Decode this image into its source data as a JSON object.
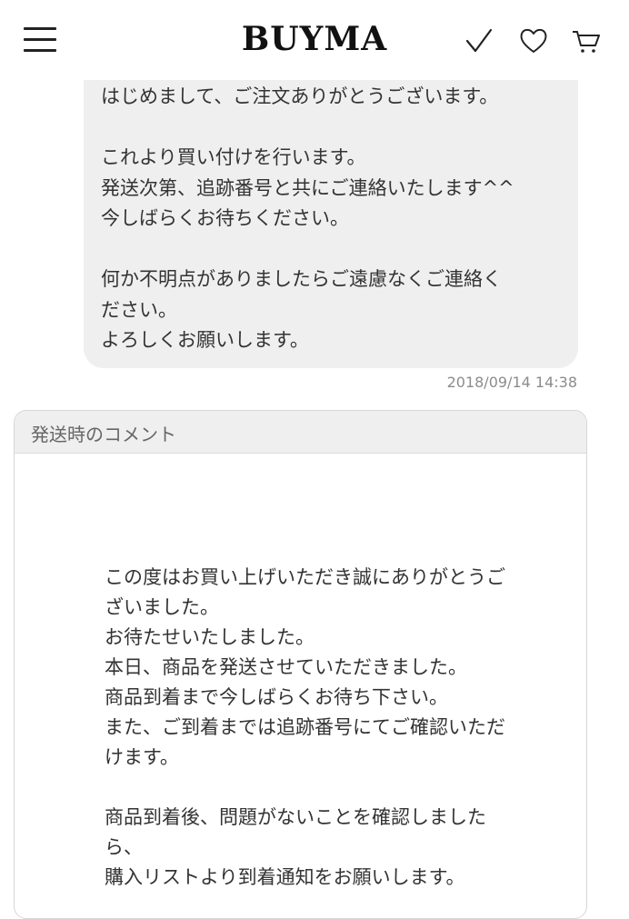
{
  "header": {
    "logo": "BUYMA",
    "icons": [
      "menu-icon",
      "check-icon",
      "heart-icon",
      "cart-icon"
    ]
  },
  "message": {
    "lines": [
      "はじめまして、ご注文ありがとうございます。",
      "",
      "これより買い付けを行います。",
      "発送次第、追跡番号と共にご連絡いたします^^",
      "今しばらくお待ちください。",
      "",
      "何か不明点がありましたらご遠慮なくご連絡く",
      "ださい。",
      "よろしくお願いします。"
    ],
    "timestamp": "2018/09/14 14:38"
  },
  "shipping_comment": {
    "title": "発送時のコメント",
    "lines": [
      "この度はお買い上げいただき誠にありがとうご",
      "ざいました。",
      "お待たせいたしました。",
      "本日、商品を発送させていただきました。",
      "商品到着まで今しばらくお待ち下さい。",
      "また、ご到着までは追跡番号にてご確認いただ",
      "けます。",
      "",
      "商品到着後、問題がないことを確認しました",
      "ら、",
      "購入リストより到着通知をお願いします。"
    ]
  },
  "colors": {
    "bubble_bg": "#efefef",
    "text": "#333333",
    "timestamp": "#8c8c8c"
  }
}
